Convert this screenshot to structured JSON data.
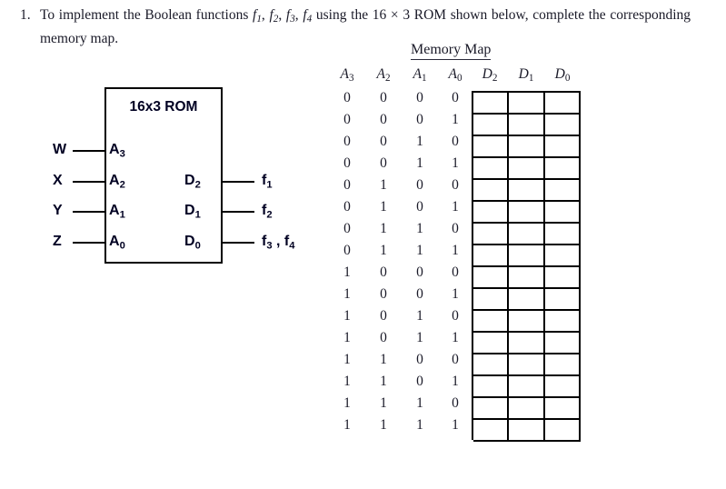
{
  "problem": {
    "number": "1.",
    "text_part_1": "To implement the Boolean functions ",
    "f1": "f",
    "f1_sub": "1",
    "sep1": ", ",
    "f2": "f",
    "f2_sub": "2",
    "sep2": ", ",
    "f3": "f",
    "f3_sub": "3",
    "sep3": ", ",
    "f4": "f",
    "f4_sub": "4",
    "text_part_2": " using the 16 × 3 ROM shown below, complete the corresponding memory map."
  },
  "rom": {
    "title": "16x3 ROM",
    "address_pins": [
      {
        "label": "A",
        "sub": "3"
      },
      {
        "label": "A",
        "sub": "2"
      },
      {
        "label": "A",
        "sub": "1"
      },
      {
        "label": "A",
        "sub": "0"
      }
    ],
    "data_pins": [
      {
        "label": "D",
        "sub": "2"
      },
      {
        "label": "D",
        "sub": "1"
      },
      {
        "label": "D",
        "sub": "0"
      }
    ],
    "inputs": [
      {
        "label": "W"
      },
      {
        "label": "X"
      },
      {
        "label": "Y"
      },
      {
        "label": "Z"
      }
    ],
    "outputs": [
      {
        "label": "f",
        "sub": "1",
        "extra": ""
      },
      {
        "label": "f",
        "sub": "2",
        "extra": ""
      },
      {
        "label": "f",
        "sub": "3",
        "extra": " , f",
        "extra_sub": "4"
      }
    ]
  },
  "memory_map": {
    "title": "Memory Map",
    "headers": [
      {
        "label": "A",
        "sub": "3"
      },
      {
        "label": "A",
        "sub": "2"
      },
      {
        "label": "A",
        "sub": "1"
      },
      {
        "label": "A",
        "sub": "0"
      },
      {
        "label": "D",
        "sub": "2"
      },
      {
        "label": "D",
        "sub": "1"
      },
      {
        "label": "D",
        "sub": "0"
      }
    ],
    "address_rows": [
      [
        "0",
        "0",
        "0",
        "0"
      ],
      [
        "0",
        "0",
        "0",
        "1"
      ],
      [
        "0",
        "0",
        "1",
        "0"
      ],
      [
        "0",
        "0",
        "1",
        "1"
      ],
      [
        "0",
        "1",
        "0",
        "0"
      ],
      [
        "0",
        "1",
        "0",
        "1"
      ],
      [
        "0",
        "1",
        "1",
        "0"
      ],
      [
        "0",
        "1",
        "1",
        "1"
      ],
      [
        "1",
        "0",
        "0",
        "0"
      ],
      [
        "1",
        "0",
        "0",
        "1"
      ],
      [
        "1",
        "0",
        "1",
        "0"
      ],
      [
        "1",
        "0",
        "1",
        "1"
      ],
      [
        "1",
        "1",
        "0",
        "0"
      ],
      [
        "1",
        "1",
        "0",
        "1"
      ],
      [
        "1",
        "1",
        "1",
        "0"
      ],
      [
        "1",
        "1",
        "1",
        "1"
      ]
    ],
    "data_rows": [
      [
        "",
        "",
        ""
      ],
      [
        "",
        "",
        ""
      ],
      [
        "",
        "",
        ""
      ],
      [
        "",
        "",
        ""
      ],
      [
        "",
        "",
        ""
      ],
      [
        "",
        "",
        ""
      ],
      [
        "",
        "",
        ""
      ],
      [
        "",
        "",
        ""
      ],
      [
        "",
        "",
        ""
      ],
      [
        "",
        "",
        ""
      ],
      [
        "",
        "",
        ""
      ],
      [
        "",
        "",
        ""
      ],
      [
        "",
        "",
        ""
      ],
      [
        "",
        "",
        ""
      ],
      [
        "",
        "",
        ""
      ],
      [
        "",
        "",
        ""
      ]
    ]
  },
  "colors": {
    "ink": "#1a1a28",
    "diagram_ink": "#000022",
    "line": "#000000",
    "background": "#ffffff"
  }
}
